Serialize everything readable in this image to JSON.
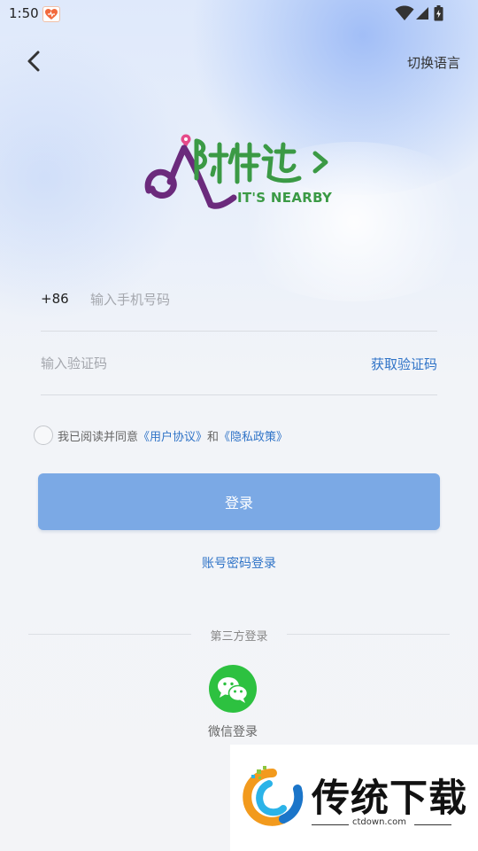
{
  "status_bar": {
    "time": "1:50"
  },
  "header": {
    "language_label": "切换语言"
  },
  "logo": {
    "tagline": "IT'S NEARBY"
  },
  "form": {
    "country_code": "+86",
    "phone_placeholder": "输入手机号码",
    "code_placeholder": "输入验证码",
    "get_code_label": "获取验证码",
    "agree_prefix": "我已阅读并同意",
    "user_agreement": "《用户协议》",
    "agree_and": "和",
    "privacy_policy": "《隐私政策》",
    "agreed": false
  },
  "login_button": "登录",
  "account_login": "账号密码登录",
  "third_party": {
    "label": "第三方登录",
    "wechat_label": "微信登录"
  },
  "watermark": {
    "title": "传统下载",
    "url": "ctdown.com"
  },
  "colors": {
    "accent": "#2f73c7",
    "login_button": "#7ba9e5",
    "wechat": "#2dc140",
    "logo_purple": "#6b2a7c",
    "logo_green": "#3b9a45"
  },
  "icons": {
    "back": "chevron-left-icon",
    "wifi": "wifi-icon",
    "signal": "signal-icon",
    "battery": "battery-icon",
    "wechat": "wechat-icon"
  }
}
